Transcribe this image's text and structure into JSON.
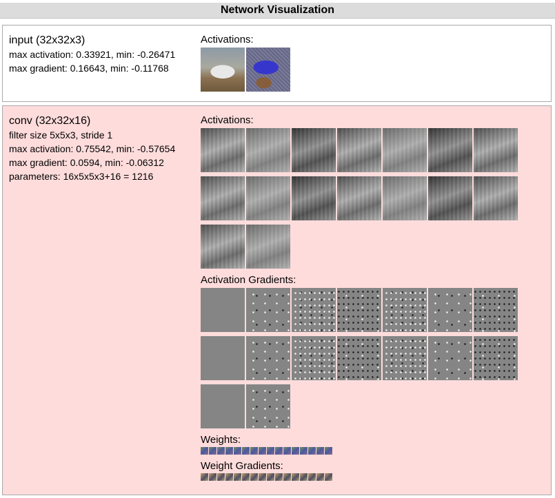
{
  "header": {
    "title": "Network Visualization"
  },
  "layers": [
    {
      "title": "input (32x32x3)",
      "lines": [
        "max activation: 0.33921, min: -0.26471",
        "max gradient: 0.16643, min: -0.11768"
      ],
      "activations_label": "Activations:"
    },
    {
      "title": "conv (32x32x16)",
      "lines": [
        "filter size 5x5x3, stride 1",
        "max activation: 0.75542, min: -0.57654",
        "max gradient: 0.0594, min: -0.06312",
        "parameters: 16x5x5x3+16 = 1216"
      ],
      "activations_label": "Activations:",
      "activation_gradients_label": "Activation Gradients:",
      "weights_label": "Weights:",
      "weight_gradients_label": "Weight Gradients:"
    }
  ],
  "colors": {
    "header_bg": "#dcdcdc",
    "input_layer_bg": "#ffffff",
    "conv_layer_bg": "#ffdcdc",
    "border": "#a9a9a9"
  }
}
